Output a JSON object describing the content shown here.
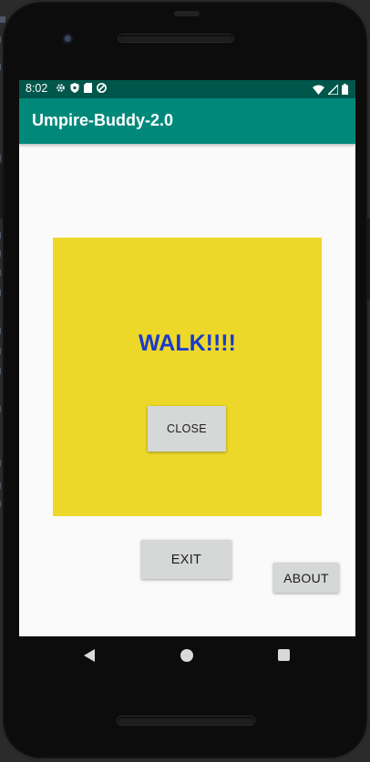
{
  "status_bar": {
    "time": "8:02",
    "left_icons": [
      "gear-icon",
      "shield-icon",
      "sd-card-icon",
      "sync-icon"
    ],
    "right_icons": [
      "wifi-icon",
      "signal-icon",
      "battery-icon"
    ]
  },
  "app_bar": {
    "title": "Umpire-Buddy-2.0"
  },
  "dialog": {
    "message": "WALK!!!!",
    "close_label": "CLOSE",
    "background": "#edd829",
    "message_color": "#1a3acb"
  },
  "buttons": {
    "exit_label": "EXIT",
    "about_label": "ABOUT"
  },
  "colors": {
    "app_bar": "#00897b",
    "status_bar": "#00564a"
  },
  "nav_bar": [
    "back-icon",
    "home-icon",
    "recents-icon"
  ]
}
